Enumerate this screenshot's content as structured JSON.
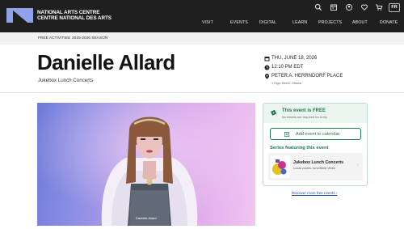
{
  "brand": {
    "name_en": "NATIONAL ARTS CENTRE",
    "name_fr": "CENTRE NATIONAL DES ARTS",
    "logo_icon": "nac-logo-icon"
  },
  "utility_icons": [
    "search-icon",
    "calendar-icon",
    "account-icon",
    "heart-icon",
    "cart-icon"
  ],
  "language_toggle": "FR",
  "nav": [
    "VISIT",
    "EVENTS",
    "DIGITAL",
    "LEARN",
    "PROJECTS",
    "ABOUT",
    "DONATE"
  ],
  "breadcrumb": [
    "FREE ACTIVITIES",
    "2025-2026 SEASON"
  ],
  "event": {
    "title": "Danielle Allard",
    "subtitle": "Jukebox Lunch Concerts",
    "date": "THU, JUNE 18, 2026",
    "time": "12:10 PM EDT",
    "venue": "PETER A. HERRNDORF PLACE",
    "venue_address": "1 Elgin Street, Ottawa"
  },
  "hero": {
    "caption": "Danielle Allard"
  },
  "card": {
    "free_title": "This event is FREE",
    "free_sub": "No tickets are required for entry",
    "add_to_calendar": "Add event to calendar",
    "series_heading": "Series featuring this event",
    "series_name": "Jukebox Lunch Concerts",
    "series_desc": "Local voices, lunchtime vibes",
    "accent_color": "#1e7a4b"
  },
  "discover_link": "Discover more free events ›"
}
